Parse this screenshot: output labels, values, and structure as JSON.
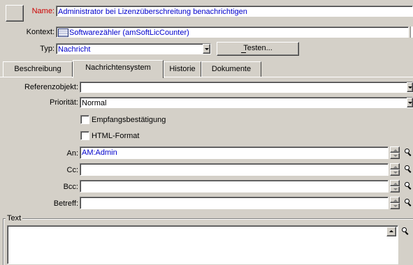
{
  "header": {
    "name_label": "Name:",
    "name_value": "Administrator bei Lizenzüberschreitung benachrichtigen",
    "context_label": "Kontext:",
    "context_value": "Softwarezähler (amSoftLicCounter)",
    "type_label": "Typ:",
    "type_value": "Nachricht",
    "test_button": "Testen..."
  },
  "tabs": [
    {
      "label": "Beschreibung",
      "active": false
    },
    {
      "label": "Nachrichtensystem",
      "active": true
    },
    {
      "label": "Historie",
      "active": false
    },
    {
      "label": "Dokumente",
      "active": false
    }
  ],
  "form": {
    "ref_label": "Referenzobjekt:",
    "ref_value": "",
    "priority_label": "Priorität:",
    "priority_value": "Normal",
    "receipt_label": "Empfangsbestätigung",
    "receipt_checked": false,
    "html_label": "HTML-Format",
    "html_checked": false,
    "to_label": "An:",
    "to_value": "AM:Admin",
    "cc_label": "Cc:",
    "cc_value": "",
    "bcc_label": "Bcc:",
    "bcc_value": "",
    "subject_label": "Betreff:",
    "subject_value": "",
    "text_label": "Text",
    "text_value": ""
  },
  "colors": {
    "accent_text": "#0000cc",
    "required_label": "#cc0000",
    "face": "#d4d0c8"
  },
  "icons": [
    "table-icon",
    "dropdown-arrow-icon",
    "spin-up-icon",
    "spin-down-icon",
    "magnifier-icon"
  ]
}
